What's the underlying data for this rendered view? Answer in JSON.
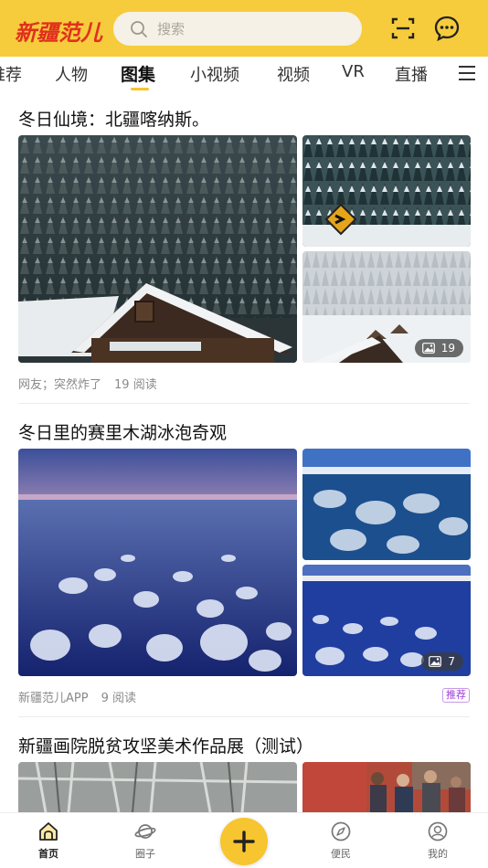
{
  "header": {
    "logo": "新疆范儿",
    "search_placeholder": "搜索",
    "icons": [
      "scan-icon",
      "message-icon"
    ]
  },
  "tabs": [
    {
      "label": "推荐"
    },
    {
      "label": "人物"
    },
    {
      "label": "图集",
      "active": true
    },
    {
      "label": "小视频"
    },
    {
      "label": "视频"
    },
    {
      "label": "VR"
    },
    {
      "label": "直播"
    }
  ],
  "articles": [
    {
      "title": "冬日仙境：北疆喀纳斯。",
      "source": "网友；突然炸了",
      "reads": "19 阅读",
      "image_count": "19"
    },
    {
      "title": "冬日里的赛里木湖冰泡奇观",
      "source": "新疆范儿APP",
      "reads": "9 阅读",
      "image_count": "7",
      "tag": "推荐"
    },
    {
      "title": "新疆画院脱贫攻坚美术作品展（测试）"
    }
  ],
  "bottom_nav": [
    {
      "label": "首页",
      "icon": "home-icon",
      "active": true
    },
    {
      "label": "圈子",
      "icon": "planet-icon"
    },
    {
      "label": "",
      "icon": "plus-icon"
    },
    {
      "label": "便民",
      "icon": "compass-icon"
    },
    {
      "label": "我的",
      "icon": "profile-icon"
    }
  ],
  "colors": {
    "header_bg": "#f6cc3c",
    "logo": "#e0301e",
    "tab_underline": "#f5c431",
    "tag": "#9b3fd6",
    "plus_button": "#f6c52f"
  }
}
